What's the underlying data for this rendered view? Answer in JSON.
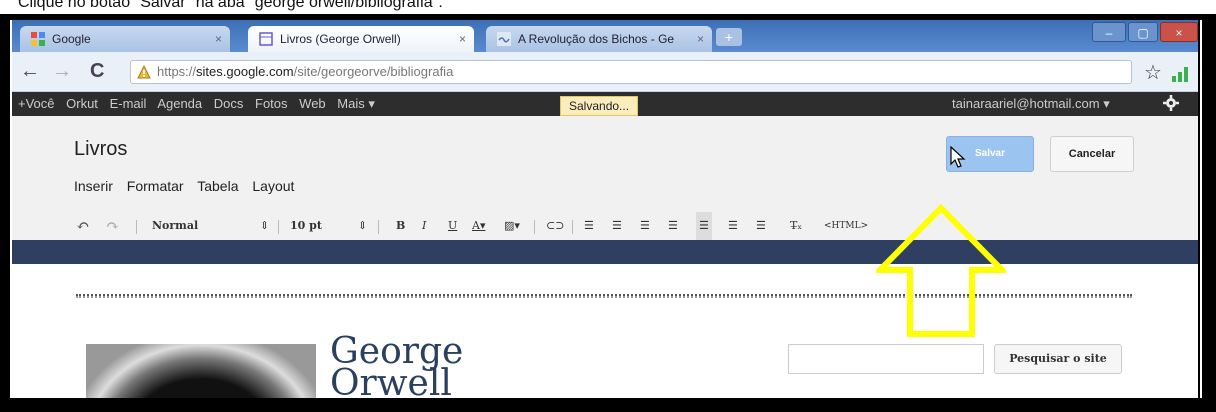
{
  "caption": "Clique no botão \"Salvar\" na aba \"george orwell/bibliografia\".",
  "browser": {
    "tabs": [
      {
        "label": "Google",
        "state": "inactive"
      },
      {
        "label": "Livros (George Orwell)",
        "state": "active"
      },
      {
        "label": "A Revolução dos Bichos - Ge",
        "state": "inactive"
      }
    ],
    "new_tab": "+",
    "url_prefix": "https://",
    "url_host": "sites.google.com",
    "url_path": "/site/georgeorve/bibliografia"
  },
  "gbar": {
    "items": [
      "+Você",
      "Orkut",
      "E-mail",
      "Agenda",
      "Docs",
      "Fotos",
      "Web",
      "Mais ▾"
    ],
    "status": "Salvando...",
    "user": "tainaraariel@hotmail.com ▾"
  },
  "editor": {
    "title": "Livros",
    "menus": [
      "Inserir",
      "Formatar",
      "Tabela",
      "Layout"
    ],
    "save_label": "Salvar",
    "cancel_label": "Cancelar",
    "style_select": "Normal",
    "size_select": "10 pt",
    "html_label": "<HTML>"
  },
  "site": {
    "name_line1": "George",
    "name_line2": "Orwell",
    "search_button": "Pesquisar o site"
  },
  "colors": {
    "highlight": "#ffff00",
    "google_bar": "#2d2d2d",
    "editor_blue": "#2f3f62",
    "save_button": "#9bc5f0"
  }
}
